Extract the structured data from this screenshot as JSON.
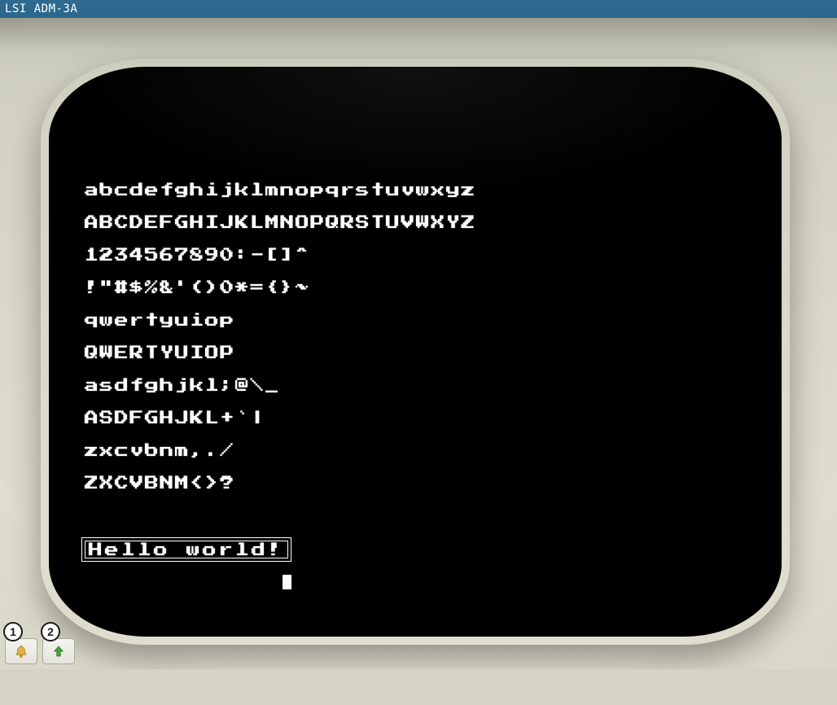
{
  "window": {
    "title": "LSI ADM-3A"
  },
  "terminal": {
    "lines": [
      "abcdefghijklmnopqrstuvwxyz",
      "ABCDEFGHIJKLMNOPQRSTUVWXYZ",
      "1234567890:-[]^",
      "!\"#$%&'()0*={}~",
      "qwertyuiop",
      "QWERTYUIOP",
      "asdfghjkl;@\\_",
      "ASDFGHJKL+`|",
      "zxcvbnm,./",
      "ZXCVBNM<>?"
    ],
    "boxed_message": "Hello world!",
    "cursor_visible": true
  },
  "toolbar": {
    "buttons": [
      {
        "badge": "1",
        "name": "bell-button",
        "icon": "bell-icon"
      },
      {
        "badge": "2",
        "name": "upload-button",
        "icon": "arrow-up-icon"
      }
    ]
  },
  "icons": {
    "bell-icon": "bell",
    "arrow-up-icon": "arrow-up"
  }
}
